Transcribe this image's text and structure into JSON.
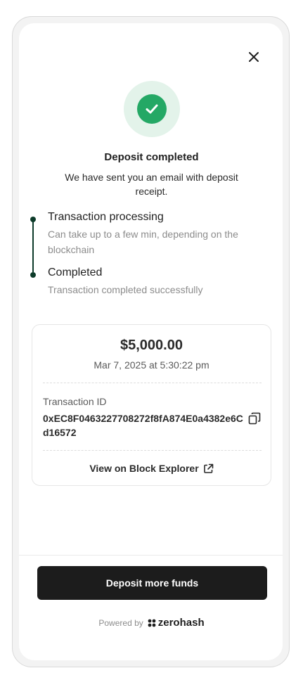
{
  "status": {
    "title": "Deposit completed",
    "message": "We have sent you an email with deposit receipt."
  },
  "timeline": [
    {
      "title": "Transaction processing",
      "description": "Can take up to a few min, depending on the blockchain"
    },
    {
      "title": "Completed",
      "description": "Transaction completed successfully"
    }
  ],
  "summary": {
    "amount": "$5,000.00",
    "date": "Mar 7, 2025 at 5:30:22 pm",
    "transaction_id_label": "Transaction ID",
    "transaction_id": "0xEC8F0463227708272f8fA874E0a4382e6Cd16572",
    "explorer_link": "View on Block Explorer"
  },
  "actions": {
    "primary_label": "Deposit more funds"
  },
  "footer": {
    "powered_by": "Powered by",
    "brand": "zerohash"
  },
  "colors": {
    "success": "#24a865",
    "success_bg": "#e3f3ea",
    "timeline": "#0d3b2a",
    "primary_button": "#1c1c1c"
  },
  "icons": [
    "close-icon",
    "check-icon",
    "copy-icon",
    "external-link-icon",
    "zerohash-logo-icon"
  ]
}
